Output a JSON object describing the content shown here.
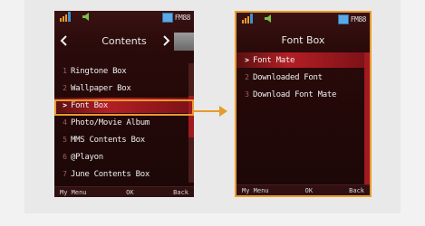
{
  "left_screen": {
    "title": "Contents",
    "battery_label": "FM88",
    "items": [
      {
        "num": "1",
        "label": "Ringtone Box",
        "selected": false
      },
      {
        "num": "2",
        "label": "Wallpaper Box",
        "selected": false
      },
      {
        "num": ">",
        "label": "Font Box",
        "selected": true
      },
      {
        "num": "4",
        "label": "Photo/Movie Album",
        "selected": false
      },
      {
        "num": "5",
        "label": "MMS Contents Box",
        "selected": false
      },
      {
        "num": "6",
        "label": "@Playon",
        "selected": false
      },
      {
        "num": "7",
        "label": "June Contents Box",
        "selected": false
      }
    ],
    "softkeys": {
      "left": "My Menu",
      "center": "OK",
      "right": "Back"
    }
  },
  "right_screen": {
    "title": "Font Box",
    "battery_label": "FM88",
    "items": [
      {
        "num": ">",
        "label": "Font Mate",
        "selected": true
      },
      {
        "num": "2",
        "label": "Downloaded Font",
        "selected": false
      },
      {
        "num": "3",
        "label": "Download Font Mate",
        "selected": false
      }
    ],
    "softkeys": {
      "left": "My Menu",
      "center": "OK",
      "right": "Back"
    }
  },
  "colors": {
    "highlight": "#e79a2d",
    "selection": "#b31f25",
    "background": "#1c0707"
  }
}
